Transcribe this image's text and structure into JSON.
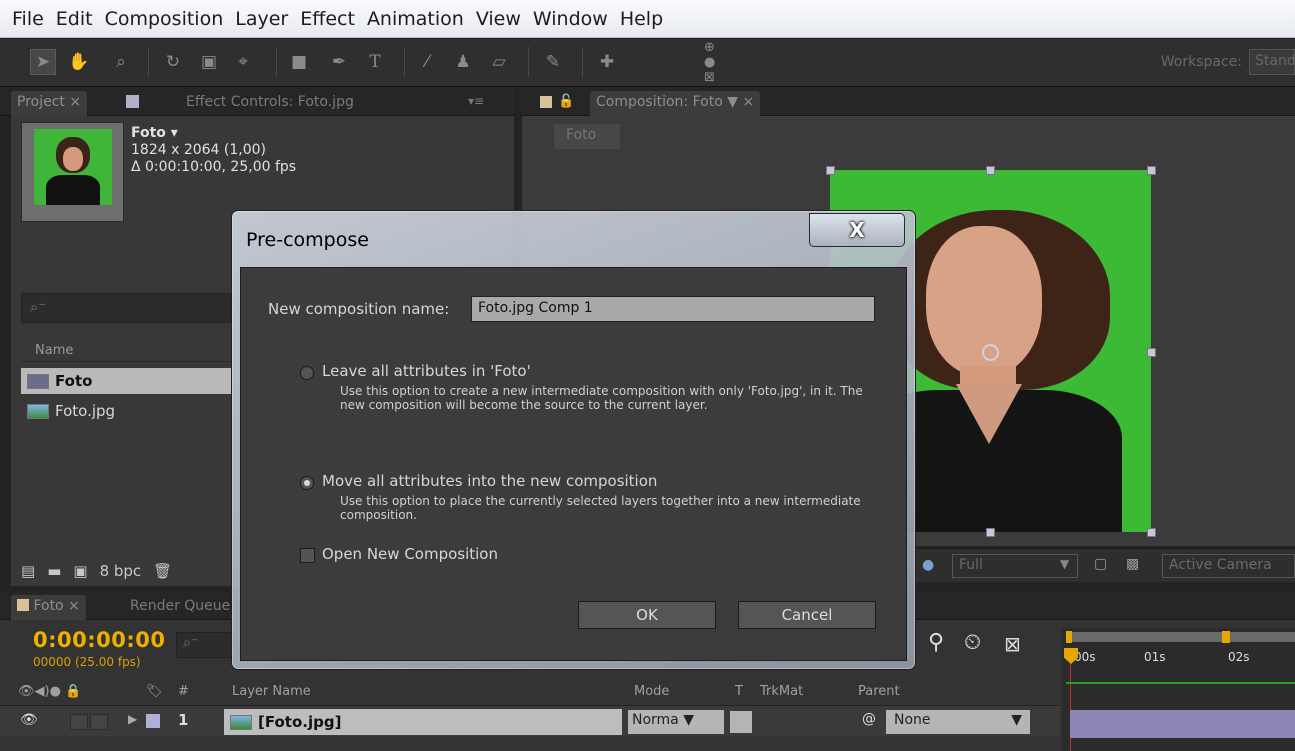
{
  "menu": [
    "File",
    "Edit",
    "Composition",
    "Layer",
    "Effect",
    "Animation",
    "View",
    "Window",
    "Help"
  ],
  "toolbar": {
    "workspace_label": "Workspace:",
    "workspace_value": "Standard"
  },
  "project_panel": {
    "tabs": {
      "project": "Project",
      "effect_controls": "Effect Controls: Foto.jpg"
    },
    "info": {
      "name": "Foto ▾",
      "dimensions": "1824 x 2064 (1,00)",
      "duration": "Δ 0:00:10:00, 25,00 fps"
    },
    "search_placeholder": "",
    "column_name": "Name",
    "items": [
      {
        "label": "Foto",
        "type": "composition"
      },
      {
        "label": "Foto.jpg",
        "type": "footage"
      }
    ],
    "bpc": "8 bpc"
  },
  "comp_panel": {
    "tab": "Composition: Foto",
    "crumb": "Foto",
    "resolution": "Full",
    "camera": "Active Camera"
  },
  "timeline": {
    "tabs": {
      "comp": "Foto",
      "render": "Render Queue"
    },
    "timecode": "0:00:00:00",
    "frames": "00000 (25.00 fps)",
    "columns": {
      "num": "#",
      "layer_name": "Layer Name",
      "mode": "Mode",
      "t": "T",
      "trkmat": "TrkMat",
      "parent": "Parent"
    },
    "ruler": [
      "00s",
      "01s",
      "02s"
    ],
    "layer": {
      "index": "1",
      "name": "[Foto.jpg]",
      "mode": "Norma",
      "parent": "None"
    }
  },
  "dialog": {
    "title": "Pre-compose",
    "close_glyph": "X",
    "name_label": "New composition name:",
    "name_value": "Foto.jpg Comp 1",
    "option1_label": "Leave all attributes in 'Foto'",
    "option1_desc": "Use this option to create a new intermediate composition with only 'Foto.jpg', in it. The new composition will become the source to the current layer.",
    "option2_label": "Move all attributes into the new composition",
    "option2_desc": "Use this option to place the currently selected layers together into a new intermediate composition.",
    "open_new_label": "Open New Composition",
    "selected_option": "option2",
    "open_new_checked": false,
    "ok": "OK",
    "cancel": "Cancel"
  },
  "colors": {
    "timecode": "#f0b000",
    "comp_bg": "#3dba35",
    "selection": "#b9b9b9"
  }
}
